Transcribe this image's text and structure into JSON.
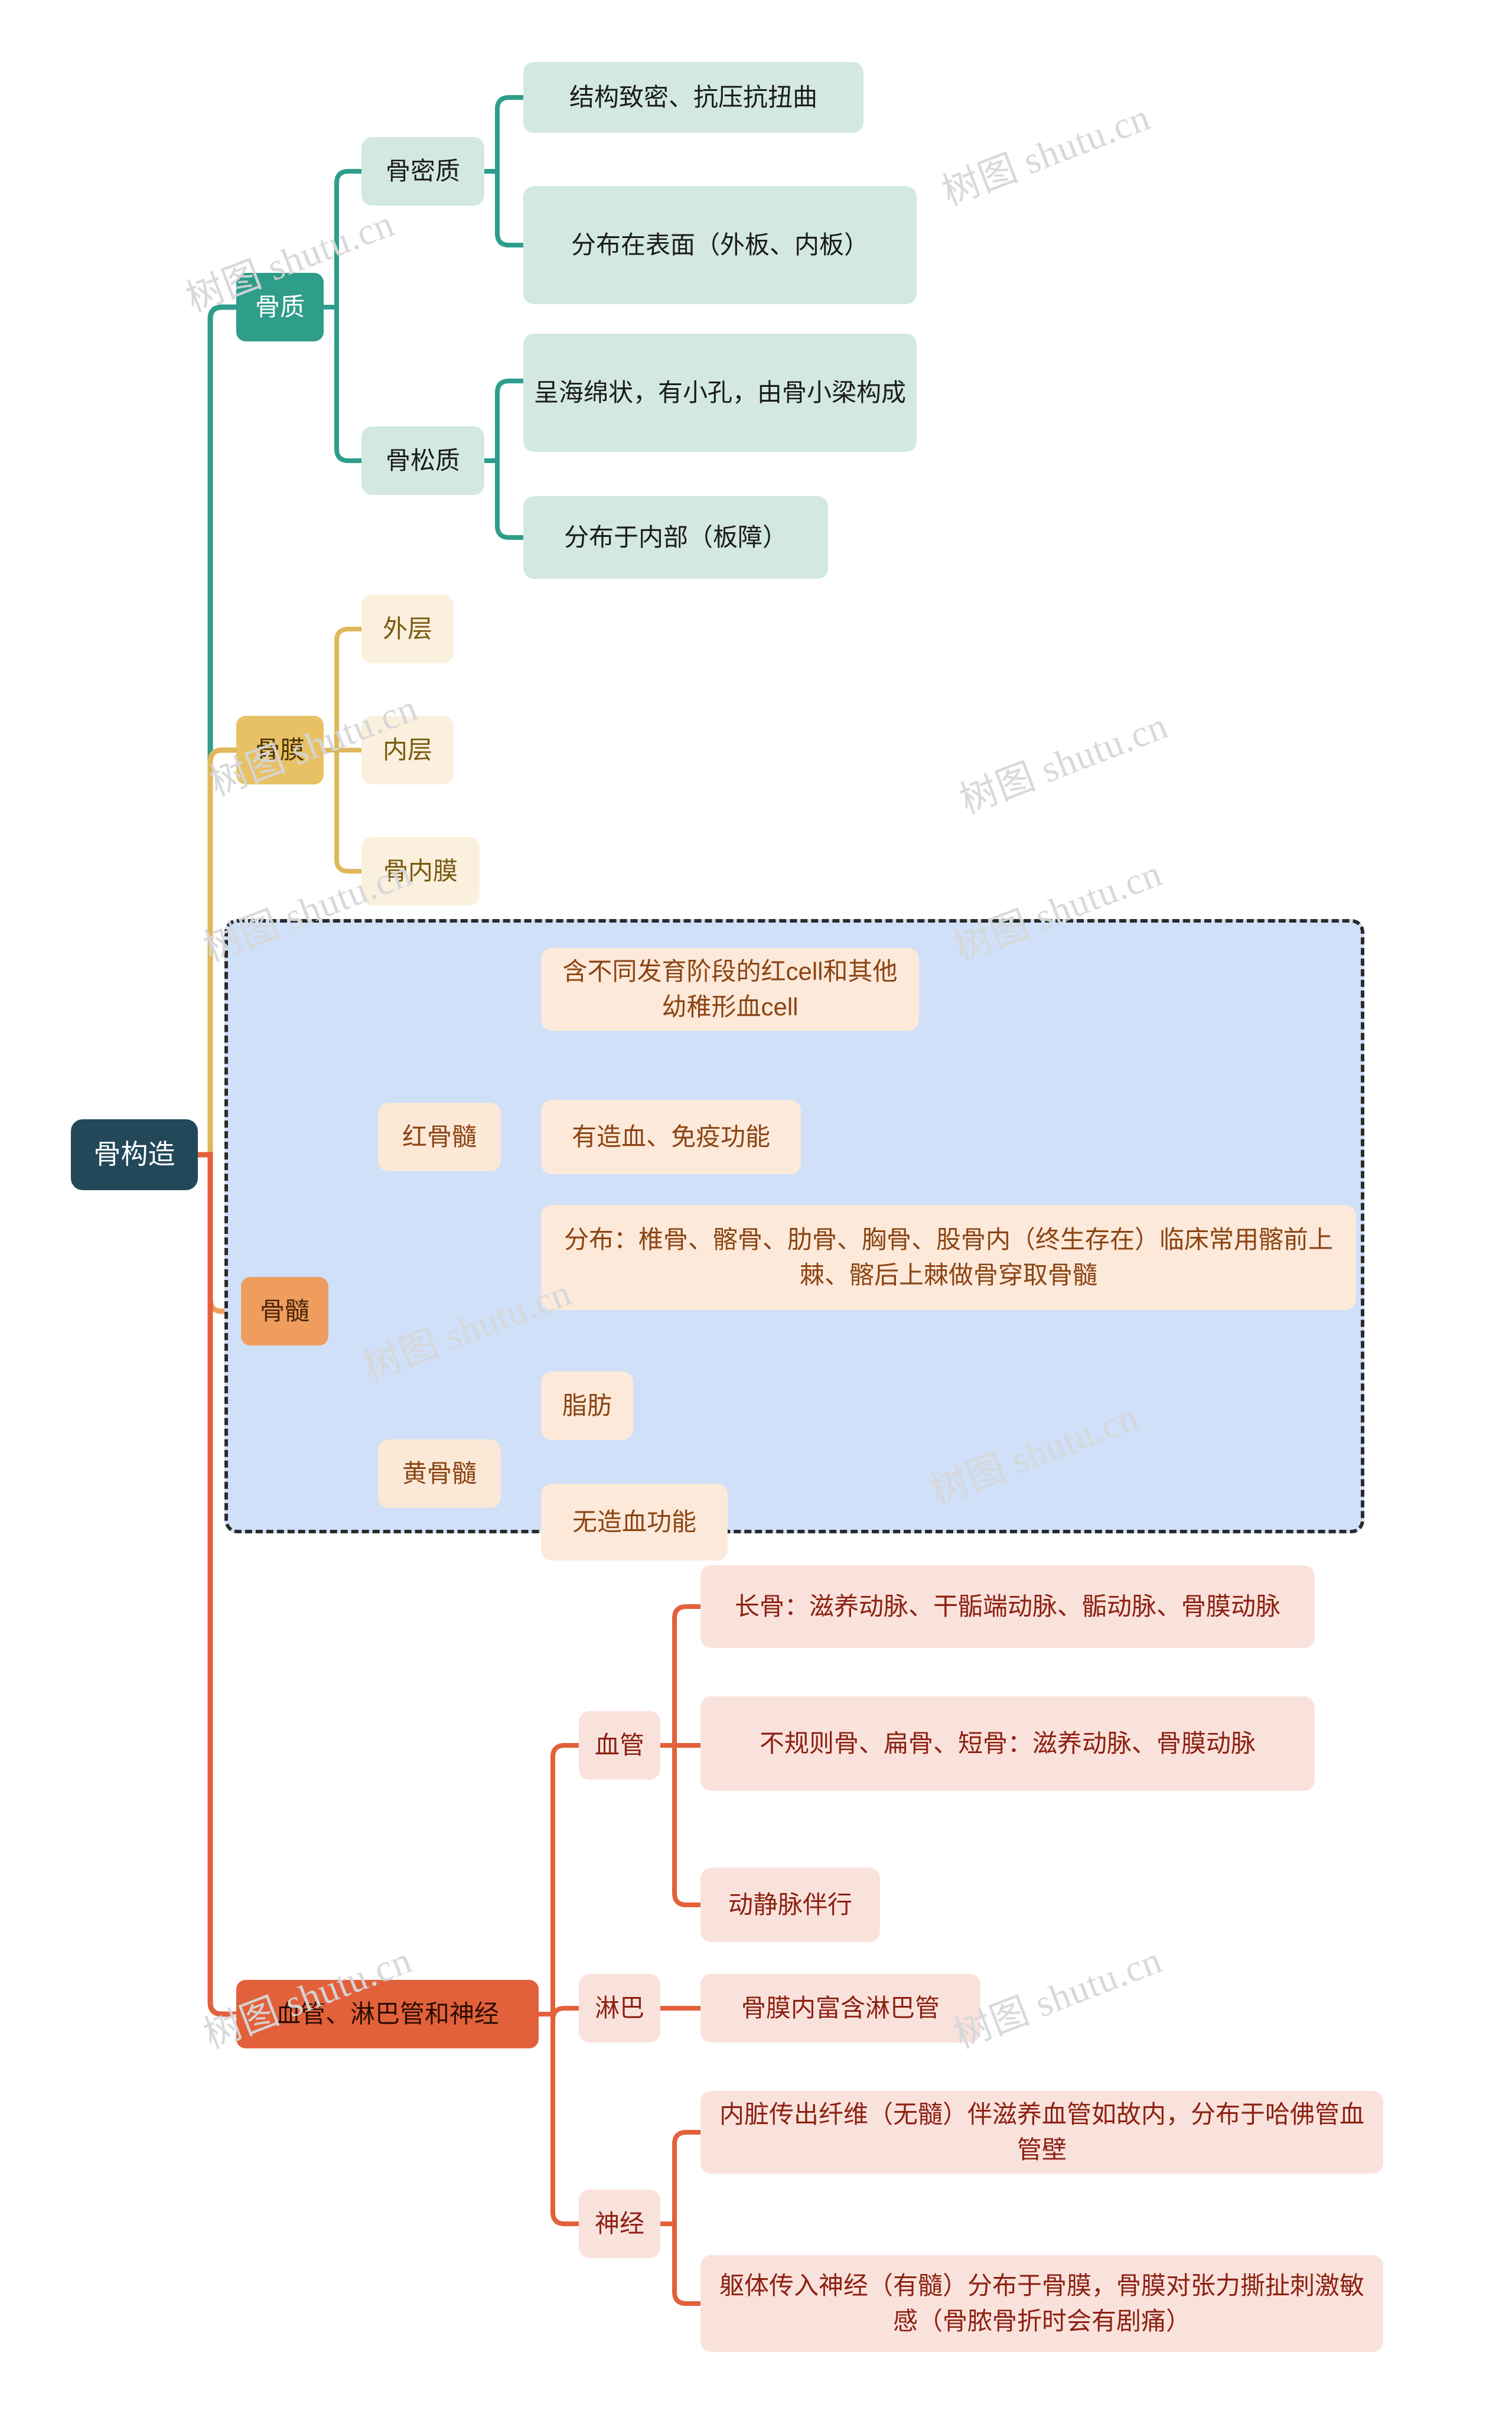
{
  "watermark": {
    "text": "树图 shutu.cn"
  },
  "theme": {
    "root_bg": "#23485a",
    "branch_bone_tissue": "#2e9d8a",
    "branch_bone_tissue_light": "#d3e8e3",
    "branch_periosteum": "#e7c164",
    "branch_periosteum_light": "#faf0dd",
    "branch_marrow": "#ef9d5e",
    "branch_marrow_light": "#fce8d7",
    "branch_vessels": "#e2613b",
    "branch_vessels_light": "#fae2dc",
    "selection_fill": "#cfe0f8",
    "selection_border": "#2b2b2b"
  },
  "root": {
    "label": "骨构造"
  },
  "branches": [
    {
      "id": "bone-tissue",
      "label": "骨质",
      "children": [
        {
          "label": "骨密质",
          "leaves": [
            "结构致密、抗压抗扭曲",
            "分布在表面（外板、内板）"
          ]
        },
        {
          "label": "骨松质",
          "leaves": [
            "呈海绵状，有小孔，由骨小梁构成",
            "分布于内部（板障）"
          ]
        }
      ]
    },
    {
      "id": "periosteum",
      "label": "骨膜",
      "children": [
        {
          "label": "外层",
          "leaves": []
        },
        {
          "label": "内层",
          "leaves": []
        },
        {
          "label": "骨内膜",
          "leaves": []
        }
      ]
    },
    {
      "id": "bone-marrow",
      "label": "骨髓",
      "selected": true,
      "children": [
        {
          "label": "红骨髓",
          "leaves": [
            "含不同发育阶段的红cell和其他幼稚形血cell",
            "有造血、免疫功能",
            "分布：椎骨、髂骨、肋骨、胸骨、股骨内（终生存在）临床常用髂前上棘、髂后上棘做骨穿取骨髓"
          ]
        },
        {
          "label": "黄骨髓",
          "leaves": [
            "脂肪",
            "无造血功能"
          ]
        }
      ]
    },
    {
      "id": "vessels-lymph-nerves",
      "label": "血管、淋巴管和神经",
      "children": [
        {
          "label": "血管",
          "leaves": [
            "长骨：滋养动脉、干骺端动脉、骺动脉、骨膜动脉",
            "不规则骨、扁骨、短骨：滋养动脉、骨膜动脉",
            "动静脉伴行"
          ]
        },
        {
          "label": "淋巴",
          "leaves": [
            "骨膜内富含淋巴管"
          ]
        },
        {
          "label": "神经",
          "leaves": [
            "内脏传出纤维（无髓）伴滋养血管如故内，分布于哈佛管血管壁",
            "躯体传入神经（有髓）分布于骨膜，骨膜对张力撕扯刺激敏感（骨脓骨折时会有剧痛）"
          ]
        }
      ]
    }
  ]
}
